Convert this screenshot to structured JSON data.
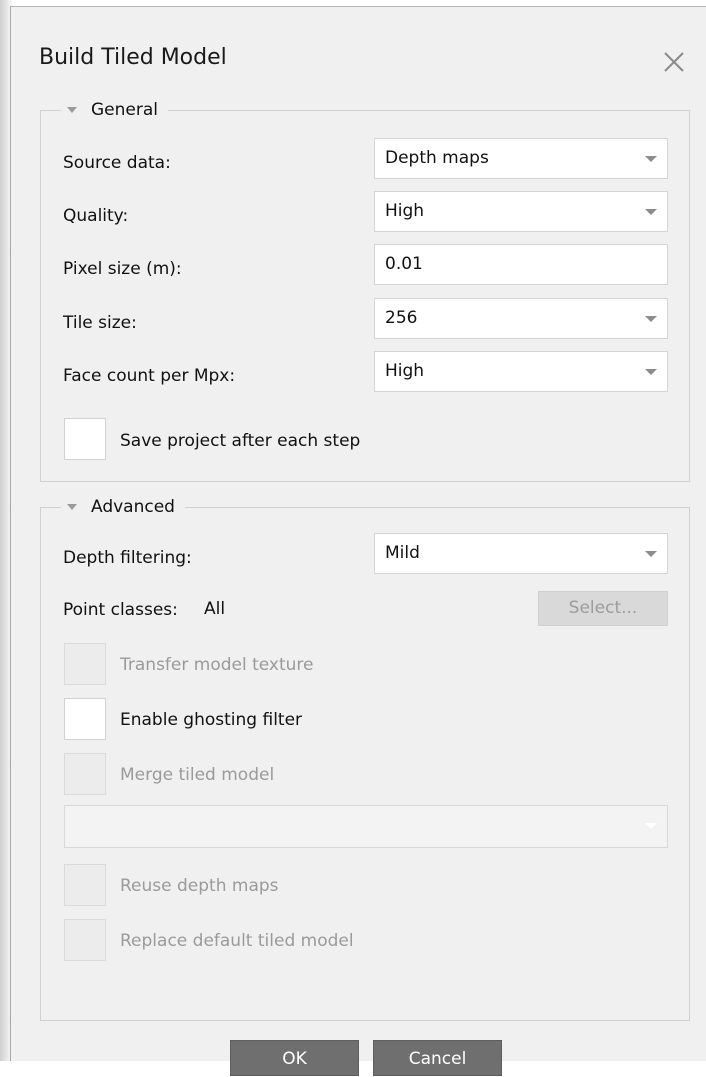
{
  "dialog": {
    "title": "Build Tiled Model"
  },
  "general": {
    "section_label": "General",
    "source_data_label": "Source data:",
    "source_data_value": "Depth maps",
    "quality_label": "Quality:",
    "quality_value": "High",
    "pixel_size_label": "Pixel size (m):",
    "pixel_size_value": "0.01",
    "tile_size_label": "Tile size:",
    "tile_size_value": "256",
    "face_count_label": "Face count per Mpx:",
    "face_count_value": "High",
    "save_project_label": "Save project after each step"
  },
  "advanced": {
    "section_label": "Advanced",
    "depth_filtering_label": "Depth filtering:",
    "depth_filtering_value": "Mild",
    "point_classes_label": "Point classes:",
    "point_classes_value": "All",
    "select_button_label": "Select...",
    "transfer_texture_label": "Transfer model texture",
    "ghosting_filter_label": "Enable ghosting filter",
    "merge_tiled_label": "Merge tiled model",
    "merge_select_value": "",
    "reuse_depth_label": "Reuse depth maps",
    "replace_default_label": "Replace default tiled model"
  },
  "footer": {
    "ok_label": "OK",
    "cancel_label": "Cancel"
  }
}
